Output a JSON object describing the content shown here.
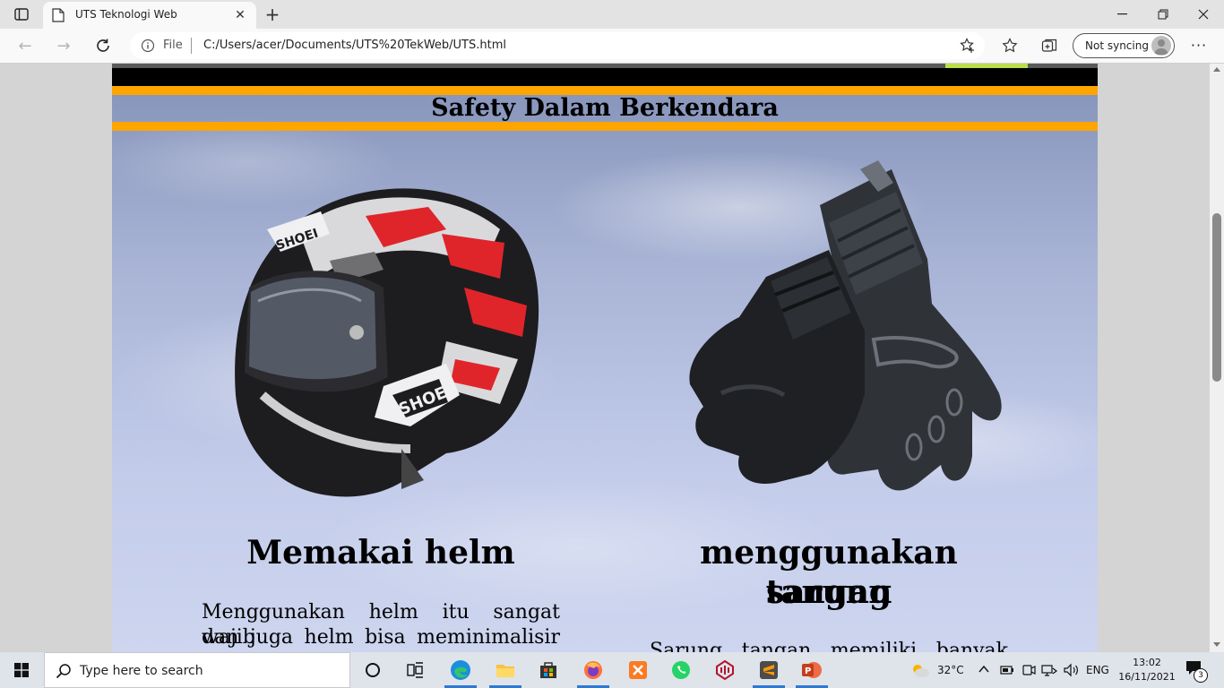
{
  "browser": {
    "tab_title": "UTS Teknologi Web",
    "address_scheme_label": "File",
    "url": "C:/Users/acer/Documents/UTS%20TekWeb/UTS.html",
    "sync_label": "Not syncing"
  },
  "page": {
    "heading": "Safety Dalam Berkendara",
    "left": {
      "title": "Memakai helm",
      "text_line1": "Menggunakan helm itu sangat wajib",
      "text_line2": "dan juga helm bisa meminimalisir",
      "image_brand": "SHOEI"
    },
    "right": {
      "title_line1": "menggunakan sarung",
      "title_line2": "tangan",
      "text_line1": "Sarung tangan memiliki banyak"
    }
  },
  "taskbar": {
    "search_placeholder": "Type here to search",
    "weather": "32°C",
    "language": "ENG",
    "time": "13:02",
    "date": "16/11/2021",
    "notifications": "3"
  },
  "colors": {
    "accent_orange": "#ffa500",
    "banner_black": "#000000",
    "sky_top": "#8391b8",
    "sky_bottom": "#cdd5ef"
  }
}
